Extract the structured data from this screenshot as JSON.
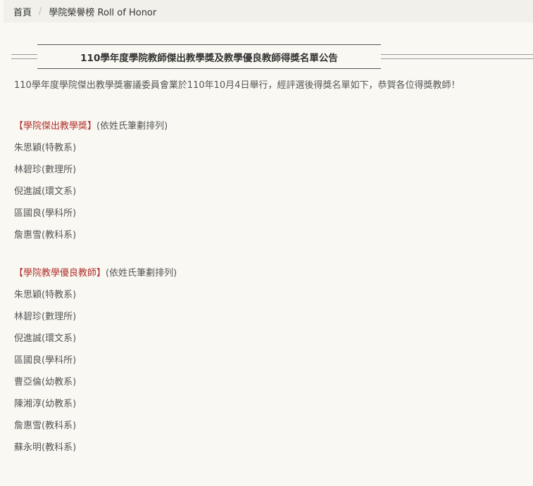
{
  "breadcrumb": {
    "home": "首頁",
    "separator": "/",
    "current": "學院榮譽榜 Roll of Honor"
  },
  "heading": "110學年度學院教師傑出教學獎及教學優良教師得獎名單公告",
  "intro": "110學年度學院傑出教學獎審議委員會業於110年10月4日舉行，經評選後得獎名單如下，恭賀各位得獎教師！",
  "sections": [
    {
      "title": "【學院傑出教學獎】",
      "note": "(依姓氏筆劃排列)",
      "names": [
        "朱思穎(特教系)",
        "林碧珍(數理所)",
        "倪進誠(環文系)",
        "區國良(學科所)",
        "詹惠雪(教科系)"
      ]
    },
    {
      "title": "【學院教學優良教師】",
      "note": "(依姓氏筆劃排列)",
      "names": [
        "朱思穎(特教系)",
        "林碧珍(數理所)",
        "倪進誠(環文系)",
        "區國良(學科所)",
        "曹亞倫(幼教系)",
        "陳湘淳(幼教系)",
        "詹惠雪(教科系)",
        "蘇永明(教科系)"
      ]
    }
  ],
  "colors": {
    "highlight": "#b0302a",
    "background": "#f9f8f3",
    "breadcrumb_bg": "#f1f0ea"
  }
}
